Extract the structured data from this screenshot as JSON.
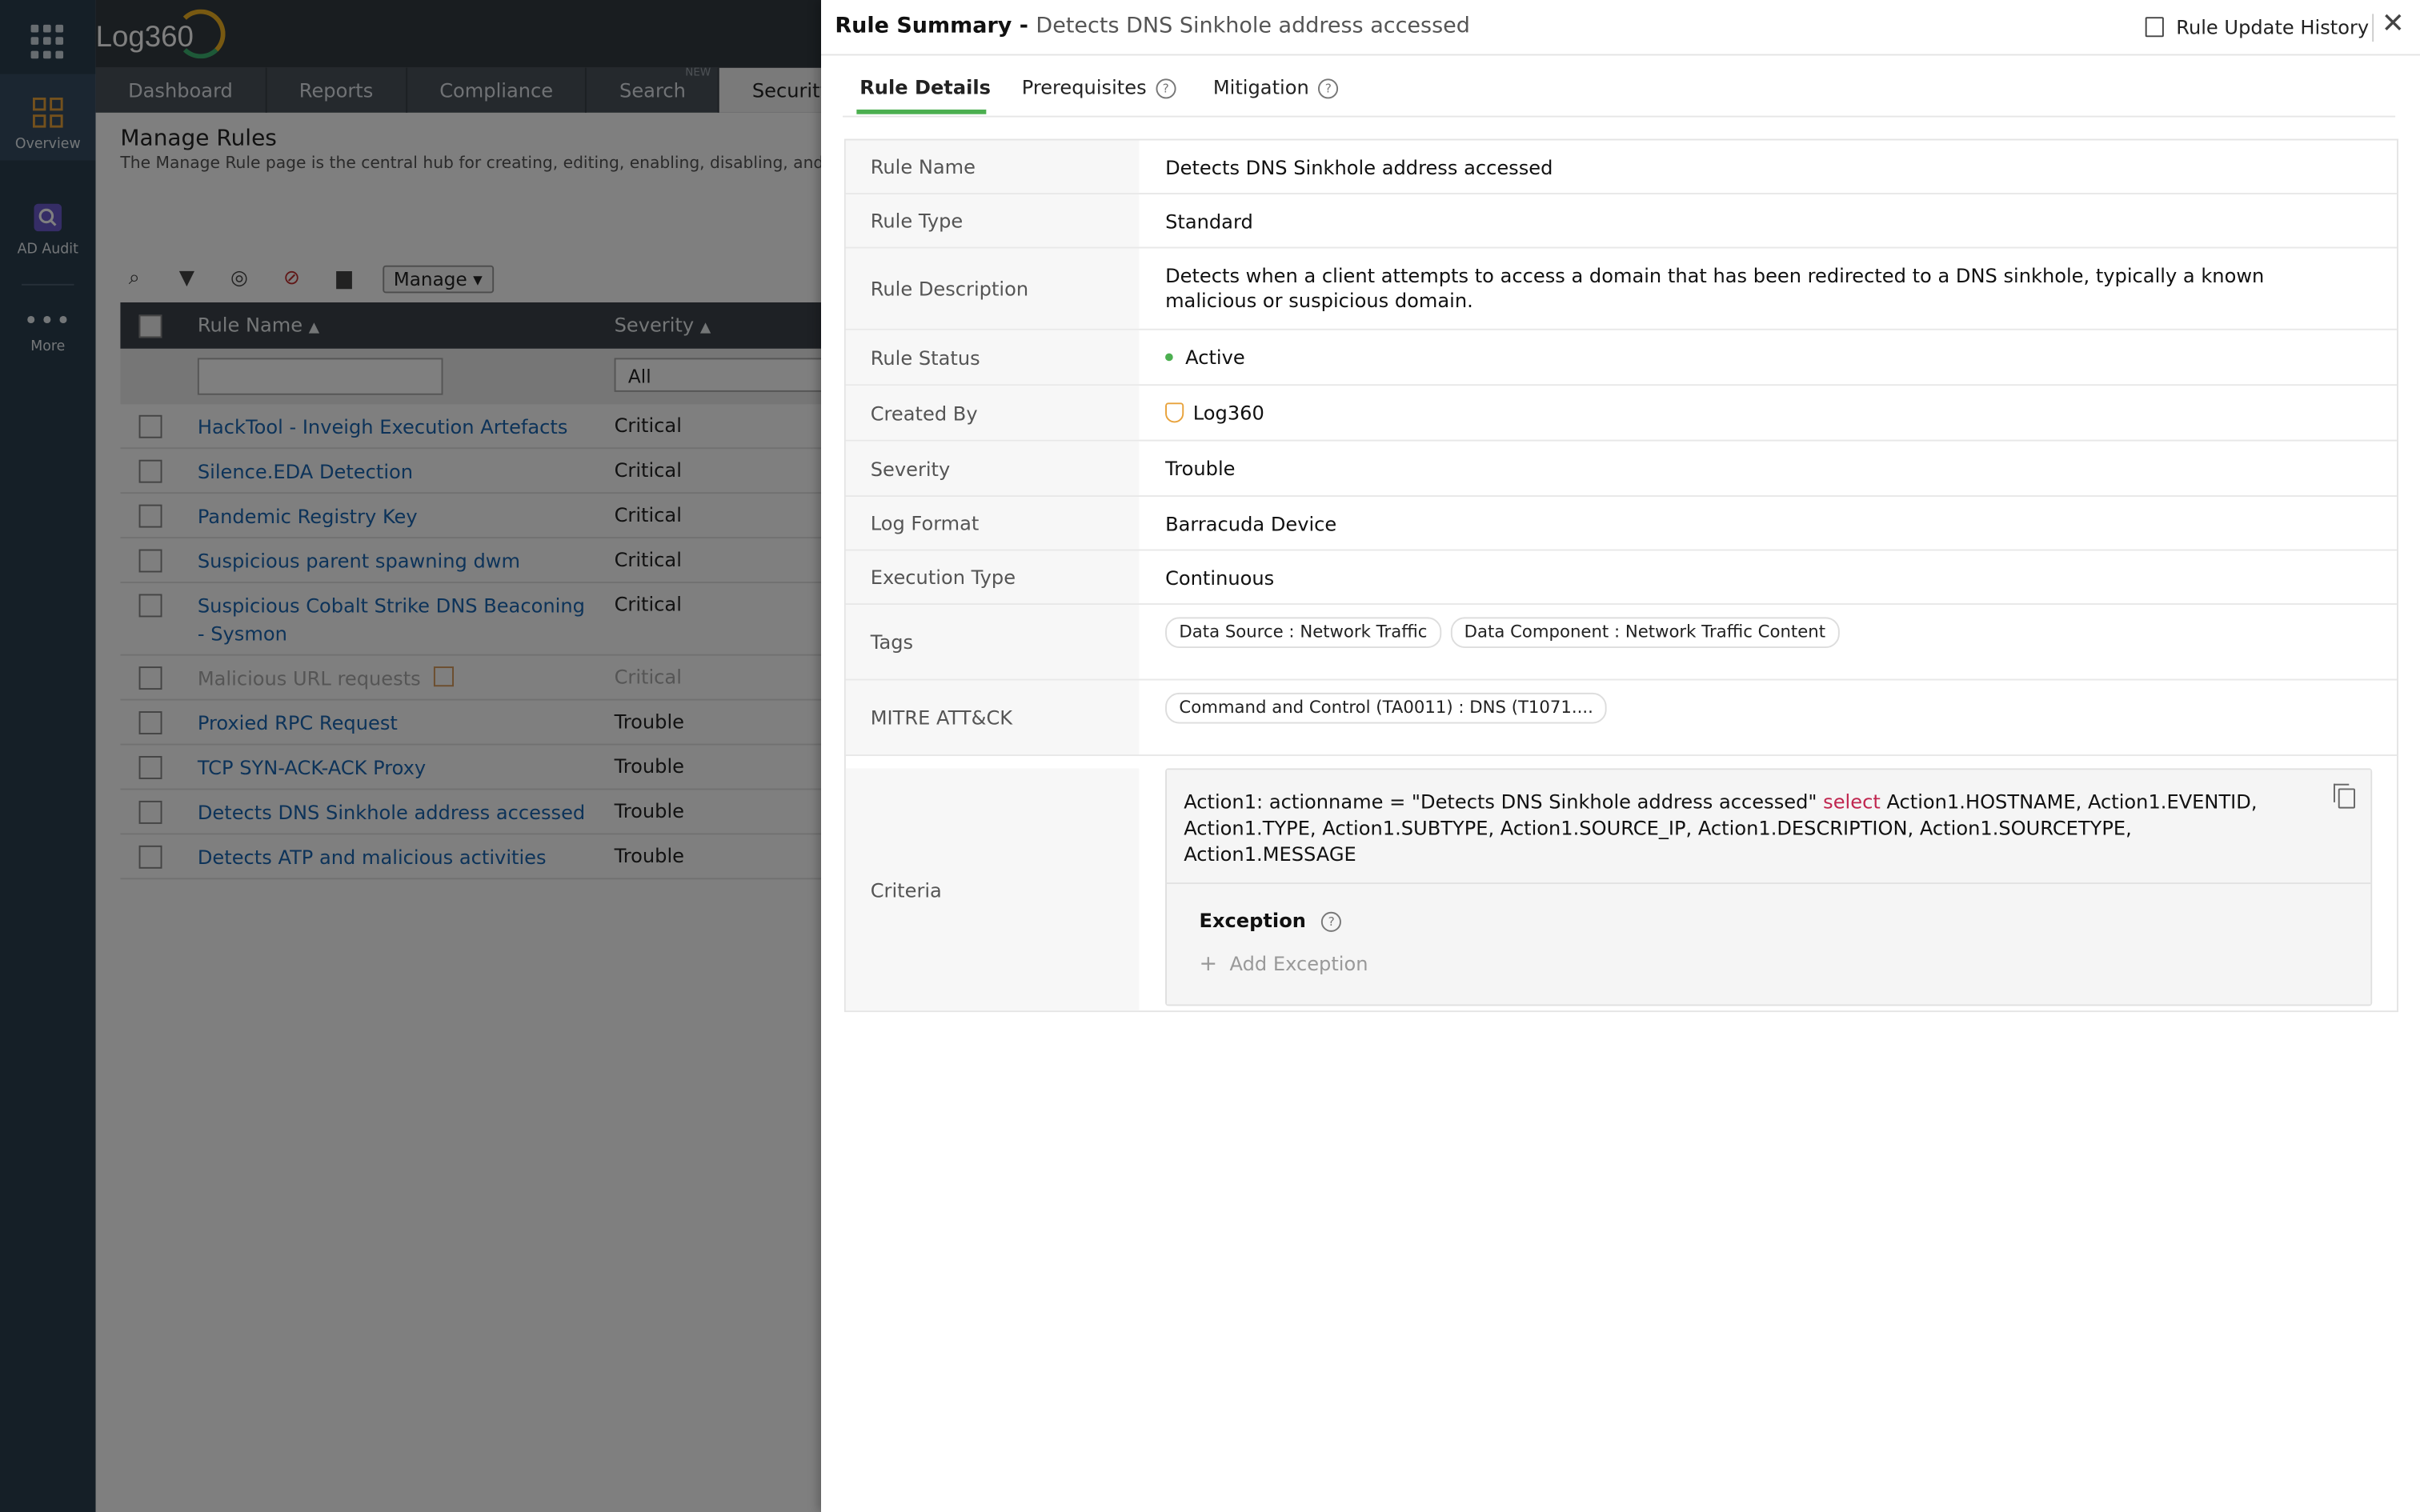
{
  "app": {
    "logo": "Log360"
  },
  "rail": {
    "items": [
      {
        "label": "Overview",
        "icon": "grid-icon"
      },
      {
        "label": "AD Audit",
        "icon": "search-icon"
      },
      {
        "label": "More",
        "icon": "more-icon"
      }
    ]
  },
  "nav": {
    "tabs": [
      "Dashboard",
      "Reports",
      "Compliance",
      "Search",
      "Security"
    ],
    "new_badge": "NEW"
  },
  "page": {
    "title": "Manage Rules",
    "description": "The Manage Rule page is the central hub for creating, editing, enabling, disabling, and"
  },
  "toolbar": {
    "manage_label": "Manage ▾"
  },
  "grid": {
    "columns": [
      "Rule Name",
      "Severity"
    ],
    "severity_filter": "All",
    "rows": [
      {
        "name": "HackTool - Inveigh Execution Artefacts",
        "severity": "Critical"
      },
      {
        "name": "Silence.EDA Detection",
        "severity": "Critical"
      },
      {
        "name": "Pandemic Registry Key",
        "severity": "Critical"
      },
      {
        "name": "Suspicious parent spawning dwm",
        "severity": "Critical"
      },
      {
        "name": "Suspicious Cobalt Strike DNS Beaconing - Sysmon",
        "severity": "Critical"
      },
      {
        "name": "Malicious URL requests",
        "severity": "Critical"
      },
      {
        "name": "Proxied RPC Request",
        "severity": "Trouble"
      },
      {
        "name": "TCP SYN-ACK-ACK Proxy",
        "severity": "Trouble"
      },
      {
        "name": "Detects DNS Sinkhole address accessed",
        "severity": "Trouble"
      },
      {
        "name": "Detects ATP and malicious activities",
        "severity": "Trouble"
      }
    ]
  },
  "drawer": {
    "title_prefix": "Rule Summary - ",
    "title_name": "Detects DNS Sinkhole address accessed",
    "history_label": "Rule Update History",
    "close": "✕",
    "tabs": [
      "Rule Details",
      "Prerequisites",
      "Mitigation"
    ],
    "details": {
      "labels": [
        "Rule Name",
        "Rule Type",
        "Rule Description",
        "Rule Status",
        "Created By",
        "Severity",
        "Log Format",
        "Execution Type",
        "Tags",
        "MITRE ATT&CK",
        "Criteria"
      ],
      "rule_name": "Detects DNS Sinkhole address accessed",
      "rule_type": "Standard",
      "rule_description": "Detects when a client attempts to access a domain that has been redirected to a DNS sinkhole, typically a known malicious or suspicious domain.",
      "rule_status": "Active",
      "created_by": "Log360",
      "severity": "Trouble",
      "log_format": "Barracuda Device",
      "execution_type": "Continuous",
      "tags": [
        "Data Source : Network Traffic",
        "Data Component : Network Traffic Content"
      ],
      "mitre": [
        "Command and Control (TA0011) : DNS (T1071...."
      ],
      "criteria": {
        "part1": "Action1: actionname = \"Detects DNS Sinkhole address accessed\" ",
        "keyword": "select",
        "part2": " Action1.HOSTNAME, Action1.EVENTID, Action1.TYPE, Action1.SUBTYPE, Action1.SOURCE_IP, Action1.DESCRIPTION, Action1.SOURCETYPE, Action1.MESSAGE"
      },
      "exception_title": "Exception",
      "add_exception": "Add Exception"
    }
  },
  "colors": {
    "accent_green": "#4caf50",
    "link_blue": "#1a66b3",
    "keyword_red": "#c0264f",
    "rail_bg": "#2b3e4f"
  }
}
